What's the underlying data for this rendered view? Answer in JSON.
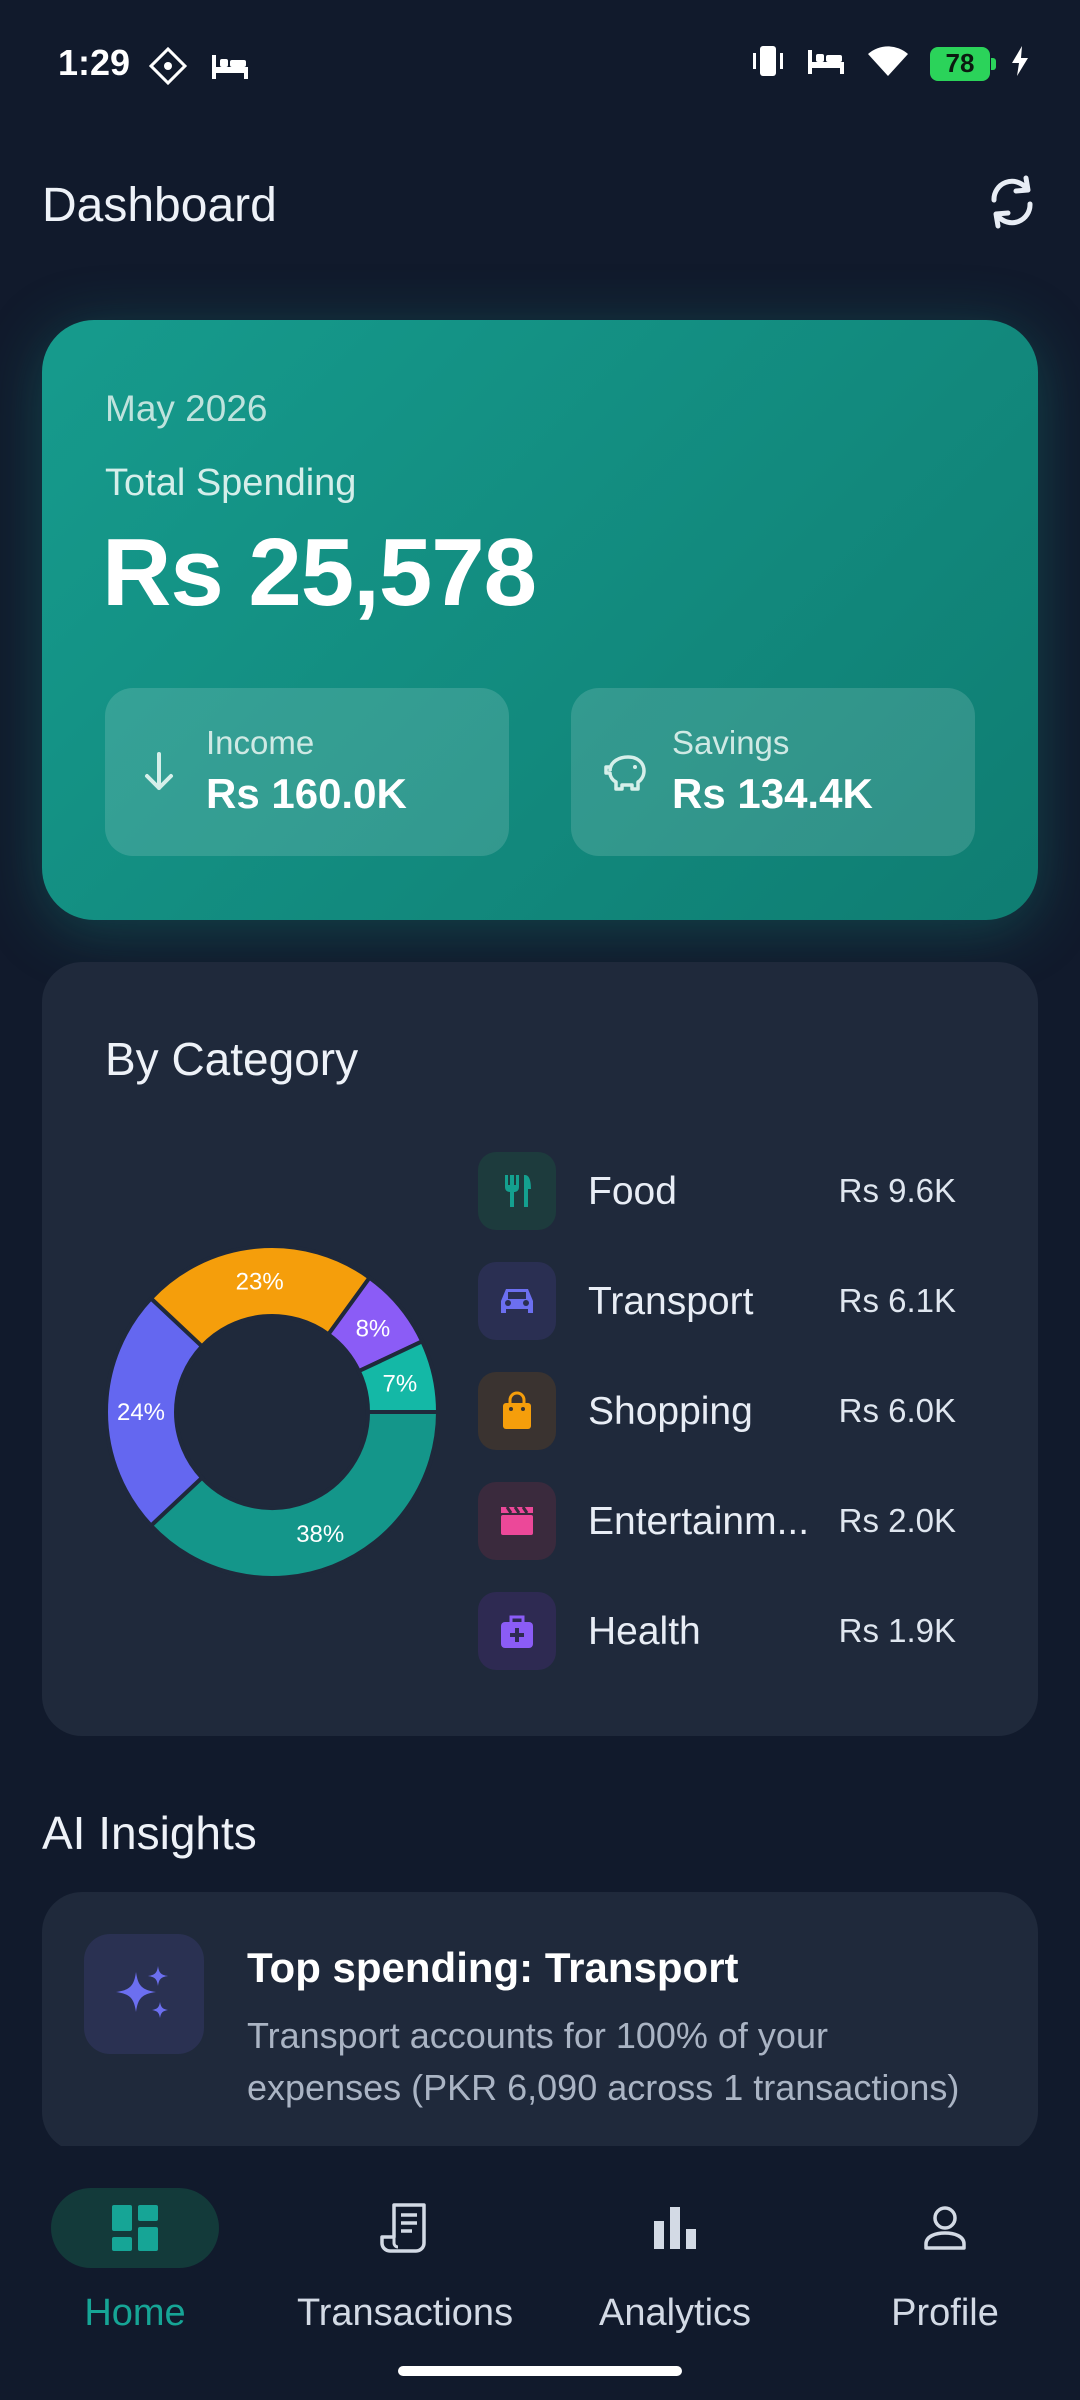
{
  "status_bar": {
    "time": "1:29",
    "battery": "78"
  },
  "header": {
    "title": "Dashboard",
    "refresh_icon": "refresh-icon"
  },
  "summary": {
    "month": "May 2026",
    "label": "Total Spending",
    "amount": "Rs 25,578",
    "income": {
      "label": "Income",
      "value": "Rs 160.0K",
      "icon": "arrow-down-icon"
    },
    "savings": {
      "label": "Savings",
      "value": "Rs 134.4K",
      "icon": "piggy-bank-icon"
    }
  },
  "category": {
    "title": "By Category",
    "items": [
      {
        "name": "Food",
        "value": "Rs 9.6K",
        "icon": "utensils-icon",
        "color": "#14a08f",
        "bg": "#1d3b3d"
      },
      {
        "name": "Transport",
        "value": "Rs 6.1K",
        "icon": "car-icon",
        "color": "#6c6ff0",
        "bg": "#2a2f52"
      },
      {
        "name": "Shopping",
        "value": "Rs 6.0K",
        "icon": "shopping-bag-icon",
        "color": "#f59e0b",
        "bg": "#3a3330"
      },
      {
        "name": "Entertainm...",
        "value": "Rs 2.0K",
        "icon": "clapperboard-icon",
        "color": "#ec4899",
        "bg": "#3a2a3d"
      },
      {
        "name": "Health",
        "value": "Rs 1.9K",
        "icon": "medical-bag-icon",
        "color": "#8b5cf6",
        "bg": "#2e2a52"
      }
    ]
  },
  "chart_data": {
    "type": "pie",
    "categories": [
      "Teal segment",
      "Indigo segment",
      "Orange segment",
      "Purple segment",
      "Cyan segment"
    ],
    "values": [
      38,
      24,
      23,
      8,
      7
    ],
    "labels": [
      "38%",
      "24%",
      "23%",
      "8%",
      "7%"
    ],
    "colors": [
      "#14968a",
      "#6467f0",
      "#f59e0b",
      "#8b5cf6",
      "#14b8a6"
    ]
  },
  "insights": {
    "title": "AI Insights",
    "items": [
      {
        "title": "Top spending: Transport",
        "text": "Transport accounts for 100% of your expenses (PKR 6,090 across 1 transactions)",
        "icon": "sparkles-icon"
      }
    ]
  },
  "nav": {
    "items": [
      {
        "label": "Home",
        "icon": "dashboard-icon",
        "active": true
      },
      {
        "label": "Transactions",
        "icon": "receipt-icon",
        "active": false
      },
      {
        "label": "Analytics",
        "icon": "bar-chart-icon",
        "active": false
      },
      {
        "label": "Profile",
        "icon": "user-icon",
        "active": false
      }
    ]
  }
}
